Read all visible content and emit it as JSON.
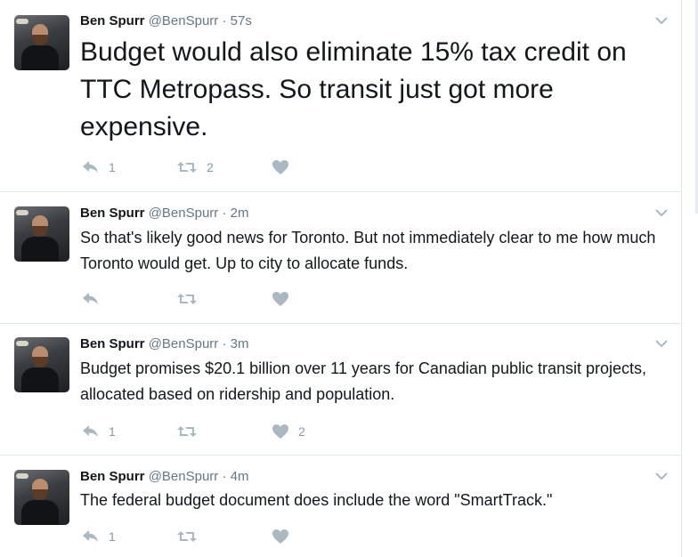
{
  "colors": {
    "name": "#14171a",
    "muted": "#657786",
    "icon": "#aab8c2",
    "divider": "#e1e8ed"
  },
  "tweets": [
    {
      "name": "Ben Spurr",
      "handle": "@BenSpurr",
      "dot": "·",
      "time": "57s",
      "text": "Budget would also eliminate 15% tax credit on TTC Metropass. So transit just got more expensive.",
      "reply_count": "1",
      "retweet_count": "2",
      "like_count": ""
    },
    {
      "name": "Ben Spurr",
      "handle": "@BenSpurr",
      "dot": "·",
      "time": "2m",
      "text": "So that's likely good news for Toronto. But not immediately clear to me how much Toronto would get. Up to city to allocate funds.",
      "reply_count": "",
      "retweet_count": "",
      "like_count": ""
    },
    {
      "name": "Ben Spurr",
      "handle": "@BenSpurr",
      "dot": "·",
      "time": "3m",
      "text": "Budget promises $20.1 billion over 11 years for Canadian public transit projects, allocated based on ridership and population.",
      "reply_count": "1",
      "retweet_count": "",
      "like_count": "2"
    },
    {
      "name": "Ben Spurr",
      "handle": "@BenSpurr",
      "dot": "·",
      "time": "4m",
      "text": "The federal budget document does include the word \"SmartTrack.\"",
      "reply_count": "1",
      "retweet_count": "",
      "like_count": ""
    }
  ],
  "icons": {
    "reply": "reply-icon",
    "retweet": "retweet-icon",
    "like": "heart-icon",
    "more": "chevron-down-icon",
    "avatar": "profile-photo"
  }
}
